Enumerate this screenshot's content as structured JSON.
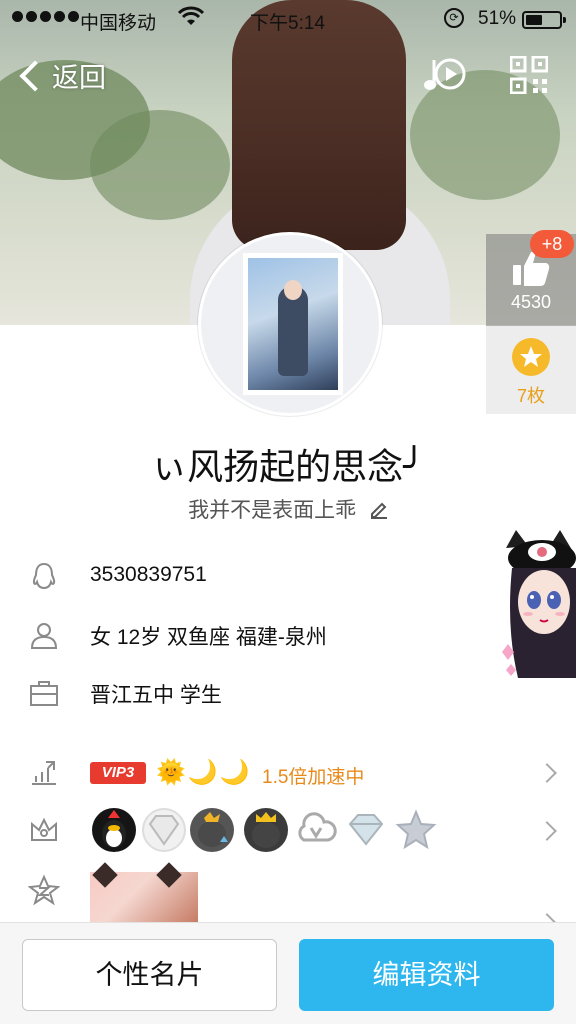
{
  "status_bar": {
    "carrier": "中国移动",
    "time": "下午5:14",
    "battery_percent": "51%",
    "battery_level": 0.51
  },
  "nav": {
    "back_label": "返回",
    "music_icon": "music-play-icon",
    "qr_icon": "qr-code-icon"
  },
  "side_panel": {
    "like_count": "4530",
    "like_increment": "+8",
    "star_count": "7枚"
  },
  "profile": {
    "nickname": "ぃ风扬起的思念╯",
    "signature": "我并不是表面上乖"
  },
  "info": {
    "qq_number": "3530839751",
    "personal": "女 12岁 双鱼座 福建-泉州",
    "school": "晋江五中 学生"
  },
  "vip": {
    "tag": "VIP3",
    "level_icons": "🌞🌙🌙",
    "speed_text": "1.5倍加速中"
  },
  "badges": [
    "qq-penguin-badge",
    "lv1-diamond-badge",
    "penguin-star-badge",
    "penguin-crown-badge",
    "cloud-v-badge",
    "diamond-badge",
    "star-badge"
  ],
  "bottom": {
    "card_label": "个性名片",
    "edit_label": "编辑资料"
  },
  "colors": {
    "accent": "#2db7ee",
    "vip_red": "#e63b2e",
    "speed_orange": "#e88a1a",
    "like_badge": "#f25a3a"
  }
}
